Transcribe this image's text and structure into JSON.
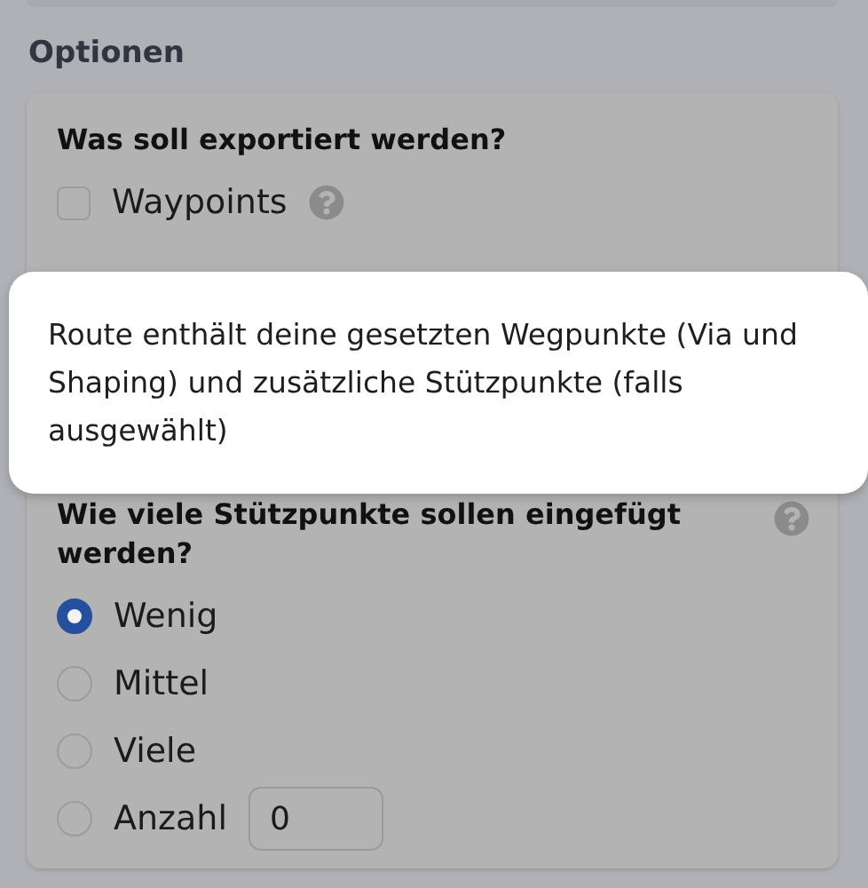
{
  "section_title": "Optionen",
  "export_group": {
    "title": "Was soll exportiert werden?",
    "options": [
      {
        "label": "Waypoints",
        "checked": false
      }
    ]
  },
  "tooltip": {
    "text": "Route enthält deine gesetzten Wegpunkte (Via und Shaping) und zusätzliche Stützpunkte (falls ausgewählt)"
  },
  "points_group": {
    "title": "Wie viele Stützpunkte sollen eingefügt werden?",
    "options": [
      {
        "label": "Wenig",
        "selected": true
      },
      {
        "label": "Mittel",
        "selected": false
      },
      {
        "label": "Viele",
        "selected": false
      },
      {
        "label": "Anzahl",
        "selected": false,
        "value": "0"
      }
    ]
  }
}
